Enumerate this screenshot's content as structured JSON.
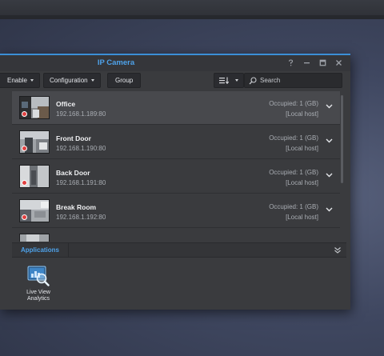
{
  "window": {
    "title": "IP Camera"
  },
  "toolbar": {
    "enable_label": "Enable",
    "configuration_label": "Configuration",
    "group_label": "Group",
    "search_placeholder": "Search"
  },
  "cameras": [
    {
      "name": "Office",
      "ip": "192.168.1.189:80",
      "occupied": "Occupied: 1 (GB)",
      "host": "[Local host]"
    },
    {
      "name": "Front Door",
      "ip": "192.168.1.190:80",
      "occupied": "Occupied: 1 (GB)",
      "host": "[Local host]"
    },
    {
      "name": "Back Door",
      "ip": "192.168.1.191:80",
      "occupied": "Occupied: 1 (GB)",
      "host": "[Local host]"
    },
    {
      "name": "Break Room",
      "ip": "192.168.1.192:80",
      "occupied": "Occupied: 1 (GB)",
      "host": "[Local host]"
    }
  ],
  "applications": {
    "tab_label": "Applications",
    "items": [
      {
        "label": "Live View Analytics",
        "icon": "live-view-analytics-icon"
      }
    ]
  },
  "colors": {
    "accent": "#4ea2ea",
    "window_bg": "#3a3b3e",
    "selected_row": "#48494d",
    "recording": "#e04040"
  }
}
